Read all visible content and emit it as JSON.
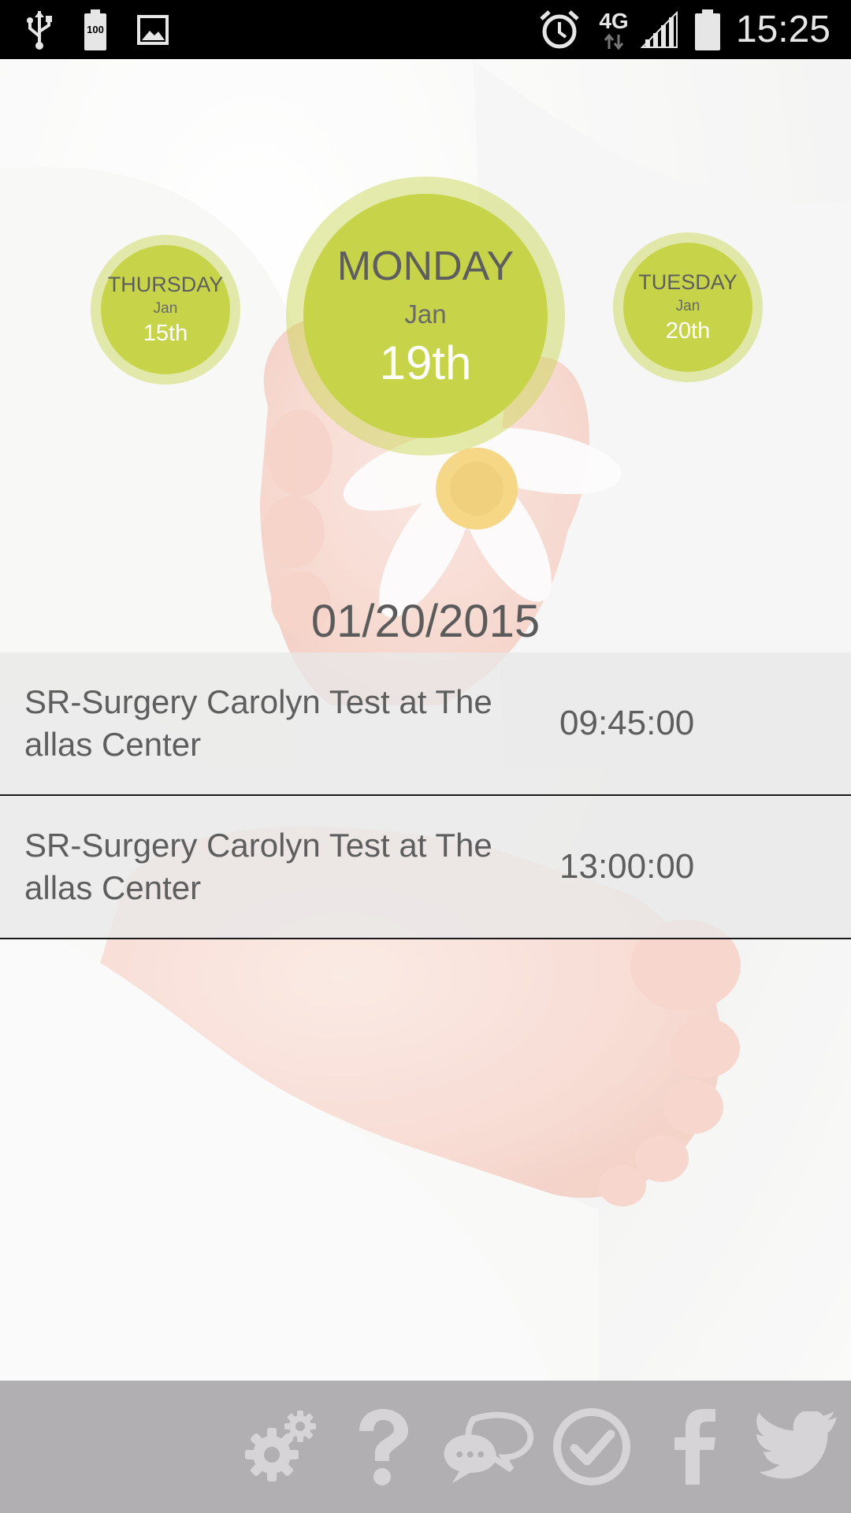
{
  "status_bar": {
    "time": "15:25",
    "battery_badge": "100",
    "network": "4G",
    "icons": [
      "usb-icon",
      "battery-saver-icon",
      "image-icon",
      "alarm-icon",
      "network-4g-icon",
      "signal-icon",
      "battery-icon"
    ]
  },
  "date_picker": {
    "prev": {
      "weekday": "THURSDAY",
      "month": "Jan",
      "day": "15th"
    },
    "current": {
      "weekday": "MONDAY",
      "month": "Jan",
      "day": "19th"
    },
    "next": {
      "weekday": "TUESDAY",
      "month": "Jan",
      "day": "20th"
    }
  },
  "selected_date": "01/20/2015",
  "appointments": [
    {
      "title": "SR-Surgery Carolyn Test at The allas Center",
      "time": "09:45:00"
    },
    {
      "title": "SR-Surgery Carolyn Test at The allas Center",
      "time": "13:00:00"
    }
  ],
  "toolbar": {
    "items": [
      "settings-icon",
      "help-icon",
      "chat-icon",
      "check-icon",
      "facebook-icon",
      "twitter-icon"
    ]
  },
  "colors": {
    "accent": "#c7d44a",
    "toolbar_bg": "#b2afb2",
    "toolbar_icon": "#d6d4d6",
    "text": "#5e5e5e"
  }
}
